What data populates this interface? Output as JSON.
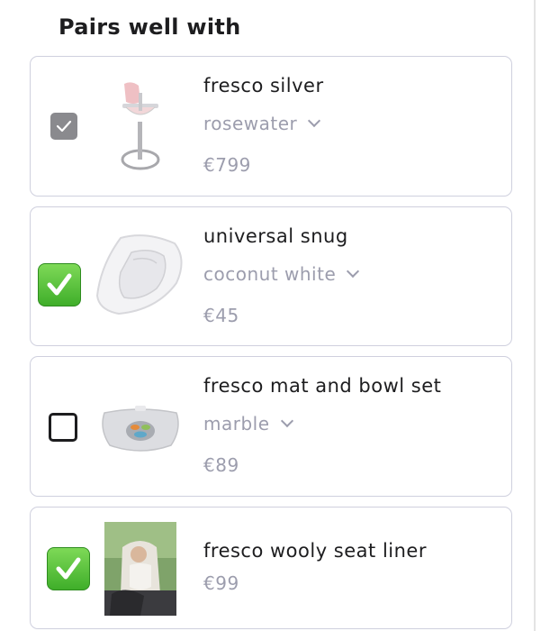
{
  "section": {
    "title": "Pairs well with"
  },
  "items": [
    {
      "name": "fresco silver",
      "variant": "rosewater",
      "price": "€799",
      "checkbox": "checked-gray",
      "image": "high-chair-rosewater"
    },
    {
      "name": "universal snug",
      "variant": "coconut white",
      "price": "€45",
      "checkbox": "checked-green",
      "image": "infant-snug-insert"
    },
    {
      "name": "fresco mat and bowl set",
      "variant": "marble",
      "price": "€89",
      "checkbox": "unchecked",
      "image": "mat-and-bowl-tray"
    },
    {
      "name": "fresco wooly seat liner",
      "price": "€99",
      "checkbox": "checked-green",
      "image": "baby-in-seat-liner-photo"
    }
  ],
  "colors": {
    "accent_green": "#4cc23a",
    "border": "#cfd0de",
    "muted_text": "#9c9dad",
    "text": "#1d1d1f"
  }
}
